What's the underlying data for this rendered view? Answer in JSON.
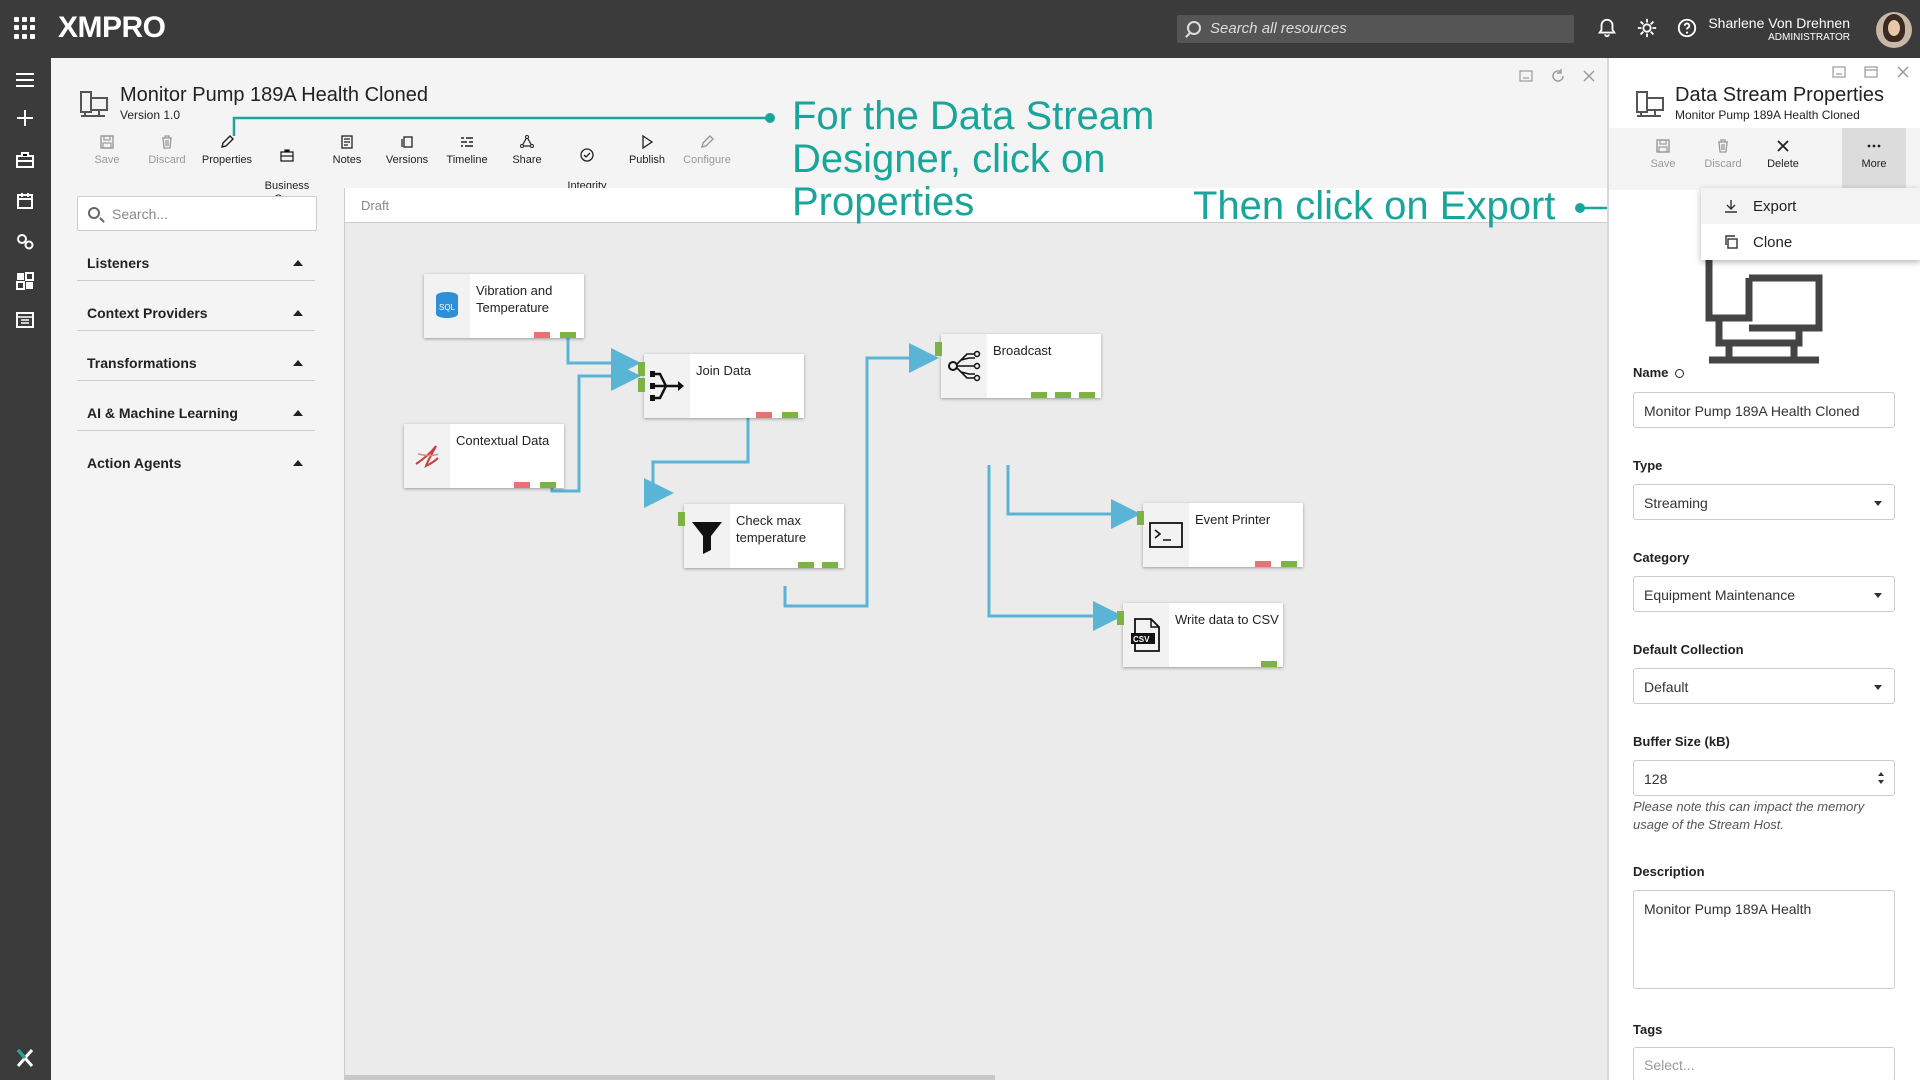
{
  "topbar": {
    "logo": "XMPRO",
    "search_placeholder": "Search all resources",
    "user_name": "Sharlene Von Drehnen",
    "user_role": "ADMINISTRATOR"
  },
  "designer": {
    "title": "Monitor Pump 189A Health Cloned",
    "version": "Version 1.0",
    "toolbar": [
      {
        "label": "Save",
        "icon": "save-icon",
        "enabled": false
      },
      {
        "label": "Discard",
        "icon": "trash-icon",
        "enabled": false
      },
      {
        "label": "Properties",
        "icon": "pencil-icon",
        "enabled": true
      },
      {
        "label": "Business\nCase",
        "icon": "briefcase-icon",
        "enabled": true
      },
      {
        "label": "Notes",
        "icon": "notes-icon",
        "enabled": true
      },
      {
        "label": "Versions",
        "icon": "versions-icon",
        "enabled": true
      },
      {
        "label": "Timeline",
        "icon": "timeline-icon",
        "enabled": true
      },
      {
        "label": "Share",
        "icon": "share-icon",
        "enabled": true
      },
      {
        "label": "Integrity\nCheck",
        "icon": "check-circle-icon",
        "enabled": true
      },
      {
        "label": "Publish",
        "icon": "play-icon",
        "enabled": true
      },
      {
        "label": "Configure",
        "icon": "pencil-icon",
        "enabled": false
      }
    ],
    "palette": {
      "search_placeholder": "Search...",
      "categories": [
        "Listeners",
        "Context Providers",
        "Transformations",
        "AI & Machine Learning",
        "Action Agents"
      ]
    },
    "canvas_status": "Draft",
    "nodes": [
      {
        "label": "Vibration and Temperature",
        "icon": "sql-database-icon"
      },
      {
        "label": "Contextual Data",
        "icon": "sql-server-icon"
      },
      {
        "label": "Join Data",
        "icon": "join-icon"
      },
      {
        "label": "Check max temperature",
        "icon": "filter-icon"
      },
      {
        "label": "Broadcast",
        "icon": "broadcast-icon"
      },
      {
        "label": "Event Printer",
        "icon": "terminal-icon"
      },
      {
        "label": "Write data to CSV",
        "icon": "csv-file-icon"
      }
    ]
  },
  "annotations": {
    "properties_hint": "For the Data Stream Designer, click on Properties",
    "export_hint": "Then click on Export"
  },
  "props": {
    "title": "Data Stream Properties",
    "subtitle": "Monitor Pump 189A Health Cloned",
    "toolbar": [
      {
        "label": "Save",
        "enabled": false
      },
      {
        "label": "Discard",
        "enabled": false
      },
      {
        "label": "Delete",
        "enabled": true
      },
      {
        "label": "More",
        "enabled": true
      }
    ],
    "menu": [
      {
        "label": "Export",
        "icon": "download-icon"
      },
      {
        "label": "Clone",
        "icon": "copy-icon"
      }
    ],
    "name_label": "Name",
    "name_value": "Monitor Pump 189A Health Cloned",
    "type_label": "Type",
    "type_value": "Streaming",
    "category_label": "Category",
    "category_value": "Equipment Maintenance",
    "collection_label": "Default Collection",
    "collection_value": "Default",
    "buffer_label": "Buffer Size (kB)",
    "buffer_value": "128",
    "buffer_note": "Please note this can impact the memory usage of the Stream Host.",
    "description_label": "Description",
    "description_value": "Monitor Pump 189A Health",
    "tags_label": "Tags",
    "tags_placeholder": "Select..."
  },
  "colors": {
    "annotation": "#1aa59a",
    "connector": "#5ab4d6",
    "port_out": "#7cb342",
    "port_error": "#e57373",
    "topbar": "#3b3b3b"
  }
}
